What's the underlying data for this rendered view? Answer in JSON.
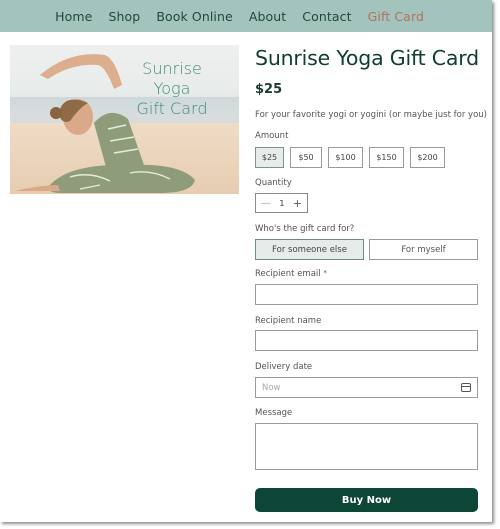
{
  "nav": {
    "items": [
      {
        "label": "Home",
        "active": false
      },
      {
        "label": "Shop",
        "active": false
      },
      {
        "label": "Book Online",
        "active": false
      },
      {
        "label": "About",
        "active": false
      },
      {
        "label": "Contact",
        "active": false
      },
      {
        "label": "Gift Card",
        "active": true
      }
    ],
    "colors": {
      "background": "#a3c4bc",
      "text": "#1d4a3c",
      "active": "#b3705f"
    }
  },
  "hero": {
    "image_alt": "Woman doing seated side stretch on beach",
    "overlay_lines": [
      "Sunrise",
      "Yoga",
      "Gift Card"
    ]
  },
  "product": {
    "title": "Sunrise Yoga Gift Card",
    "price": "$25",
    "description": "For your favorite yogi or yogini (or maybe just for you)"
  },
  "amount": {
    "label": "Amount",
    "options": [
      "$25",
      "$50",
      "$100",
      "$150",
      "$200"
    ],
    "selected": "$25"
  },
  "quantity": {
    "label": "Quantity",
    "value": "1",
    "minus_icon": "minus-icon",
    "plus_icon": "plus-icon"
  },
  "recipient_type": {
    "label": "Who's the gift card for?",
    "options": [
      "For someone else",
      "For myself"
    ],
    "selected": "For someone else"
  },
  "form": {
    "email_label": "Recipient email",
    "email_required": "*",
    "email_value": "",
    "name_label": "Recipient name",
    "name_value": "",
    "date_label": "Delivery date",
    "date_placeholder": "Now",
    "date_icon": "calendar-icon",
    "message_label": "Message",
    "message_value": ""
  },
  "buy_button": {
    "label": "Buy Now",
    "color": "#0c4636"
  }
}
